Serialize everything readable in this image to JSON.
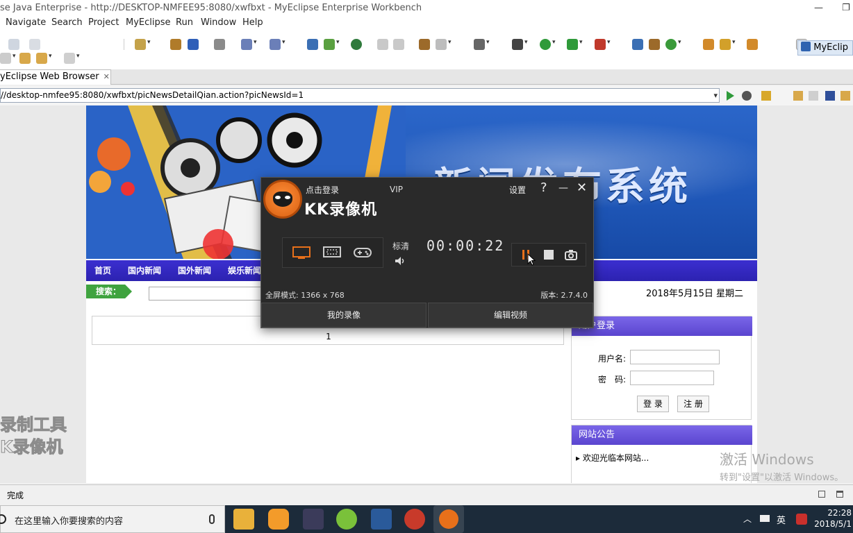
{
  "window": {
    "title": "se Java Enterprise - http://DESKTOP-NMFEE95:8080/xwfbxt - MyEclipse Enterprise Workbench"
  },
  "menu": [
    "Navigate",
    "Search",
    "Project",
    "MyEclipse",
    "Run",
    "Window",
    "Help"
  ],
  "perspective_label": "MyEclip",
  "browser_tab": {
    "label": "yEclipse Web Browser"
  },
  "address": "//desktop-nmfee95:8080/xwfbxt/picNewsDetailQian.action?picNewsId=1",
  "site": {
    "banner_title": "新闻发布系统",
    "nav": [
      "首页",
      "国内新闻",
      "国外新闻",
      "娱乐新闻"
    ],
    "search_label": "搜索：",
    "date": "2018年5月15日 星期二",
    "pagination": "1",
    "login": {
      "title": "用户登录",
      "username_label": "用户名:",
      "password_label": "密　码:",
      "login_button": "登 录",
      "register_button": "注 册"
    },
    "notice": {
      "title": "网站公告",
      "item": "欢迎光临本网站..."
    }
  },
  "kk": {
    "login": "点击登录",
    "vip": "VIP",
    "brand": "KK录像机",
    "settings": "设置",
    "help": "?",
    "minimize": "—",
    "close": "✕",
    "quality": "标清",
    "timer": "00:00:22",
    "fullscreen_mode": "全屏模式: 1366 x 768",
    "version": "版本: 2.7.4.0",
    "my_recordings": "我的录像",
    "edit_video": "编辑视频"
  },
  "watermark": {
    "kk_line1": "录制工具",
    "kk_line2": "K录像机",
    "win_line1": "激活 Windows",
    "win_line2": "转到\"设置\"以激活 Windows。"
  },
  "status": "完成",
  "taskbar": {
    "search_placeholder": "在这里输入你要搜索的内容",
    "ime": "英",
    "time": "22:28",
    "date": "2018/5/1"
  },
  "colors": {
    "banner_blue": "#2b66c9",
    "nav_purple": "#3b2fd0",
    "panel_purple": "#6a55de",
    "kk_orange": "#e8701a",
    "kk_bg": "#2a2a2a"
  }
}
